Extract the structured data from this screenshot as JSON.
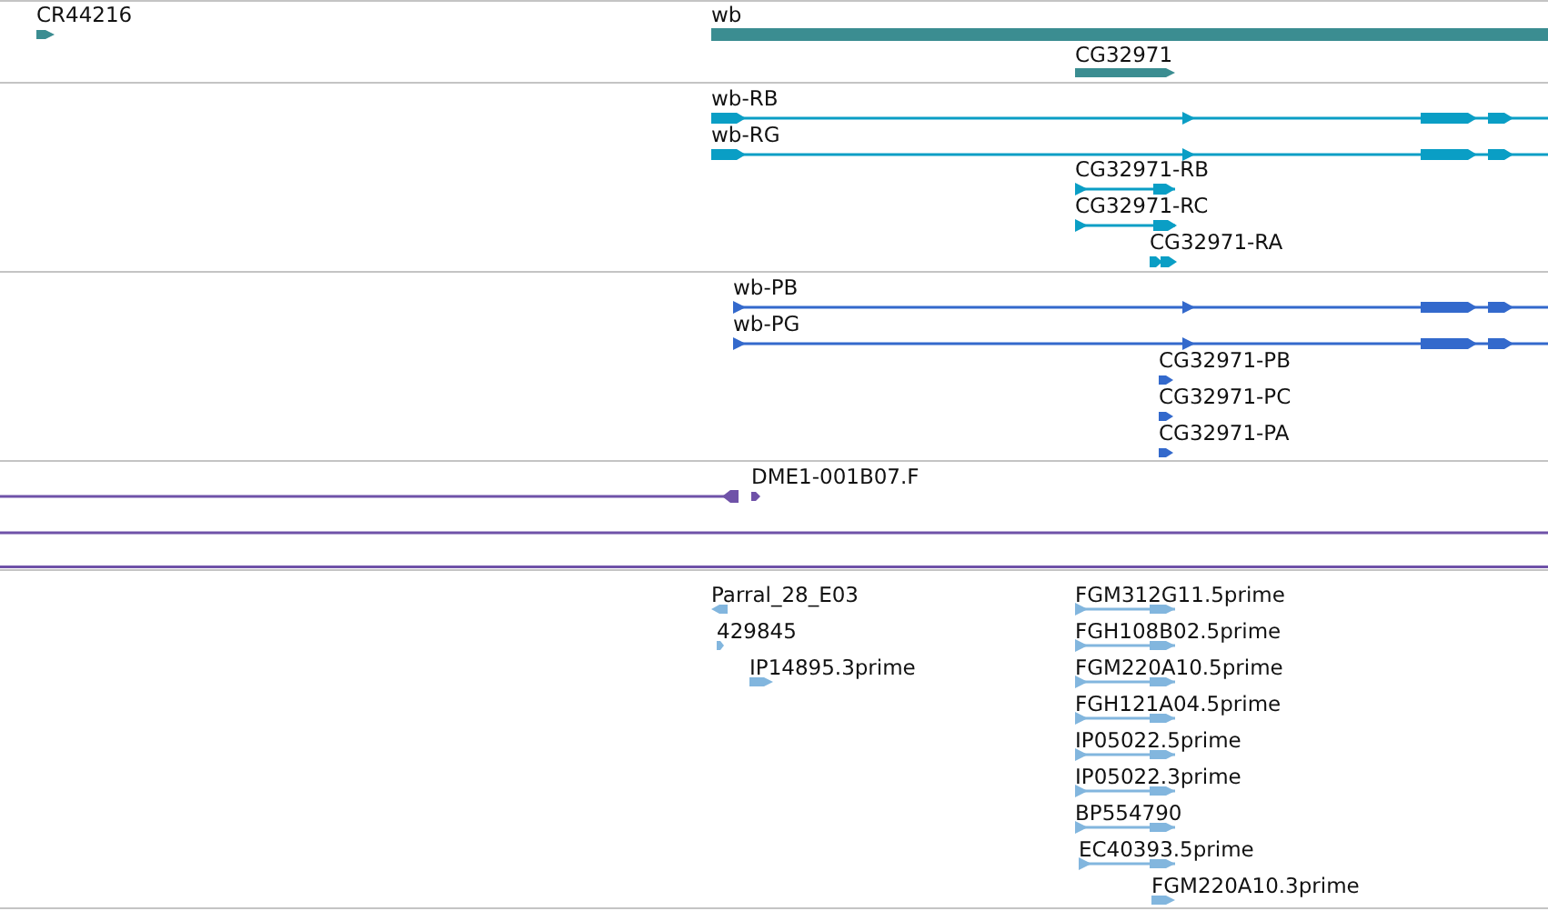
{
  "tracks": [
    {
      "kind": "gene",
      "features": [
        {
          "label": "CR44216"
        },
        {
          "label": "wb"
        },
        {
          "label": "CG32971"
        }
      ]
    },
    {
      "kind": "transcript",
      "features": [
        {
          "label": "wb-RB"
        },
        {
          "label": "wb-RG"
        },
        {
          "label": "CG32971-RB"
        },
        {
          "label": "CG32971-RC"
        },
        {
          "label": "CG32971-RA"
        }
      ]
    },
    {
      "kind": "protein",
      "features": [
        {
          "label": "wb-PB"
        },
        {
          "label": "wb-PG"
        },
        {
          "label": "CG32971-PB"
        },
        {
          "label": "CG32971-PC"
        },
        {
          "label": "CG32971-PA"
        }
      ]
    },
    {
      "kind": "clone",
      "features": [
        {
          "label": "DME1-001B07.F"
        }
      ]
    },
    {
      "kind": "est",
      "features": [
        {
          "label": "Parral_28_E03"
        },
        {
          "label": "429845"
        },
        {
          "label": "IP14895.3prime"
        },
        {
          "label": "FGM312G11.5prime"
        },
        {
          "label": "FGH108B02.5prime"
        },
        {
          "label": "FGM220A10.5prime"
        },
        {
          "label": "FGH121A04.5prime"
        },
        {
          "label": "IP05022.5prime"
        },
        {
          "label": "IP05022.3prime"
        },
        {
          "label": "BP554790"
        },
        {
          "label": "EC40393.5prime"
        },
        {
          "label": "FGM220A10.3prime"
        }
      ]
    }
  ]
}
